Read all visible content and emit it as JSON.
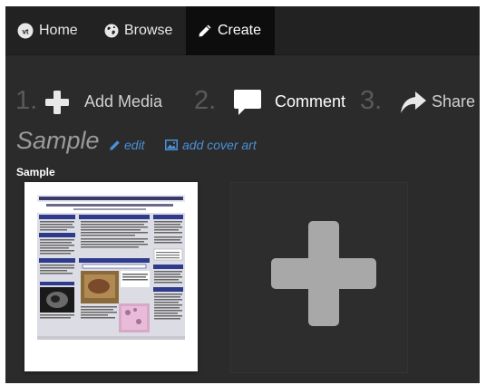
{
  "nav": {
    "home_label": "Home",
    "browse_label": "Browse",
    "create_label": "Create"
  },
  "steps": [
    {
      "number": "1.",
      "label": "Add Media",
      "icon": "plus-icon"
    },
    {
      "number": "2.",
      "label": "Comment",
      "icon": "speech-bubble-icon"
    },
    {
      "number": "3.",
      "label": "Share",
      "icon": "share-arrow-icon"
    }
  ],
  "collection": {
    "title": "Sample",
    "edit_label": "edit",
    "cover_label": "add cover art"
  },
  "media": [
    {
      "label": "Sample",
      "thumbnail": "poster"
    }
  ],
  "colors": {
    "background": "#2b2b2b",
    "navbar": "#222222",
    "active_tab": "#0d0d0d",
    "link": "#4a90d9",
    "plus": "#a8a8a8"
  }
}
